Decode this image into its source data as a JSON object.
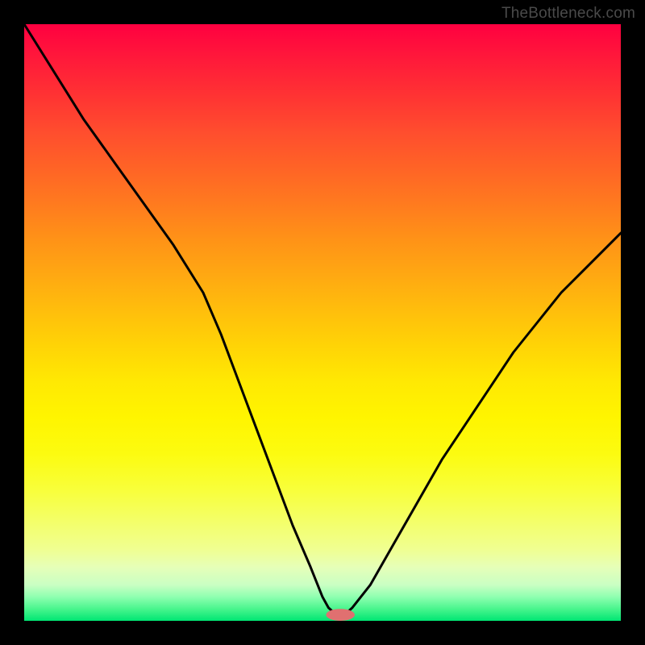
{
  "watermark": "TheBottleneck.com",
  "chart_data": {
    "type": "line",
    "title": "",
    "xlabel": "",
    "ylabel": "",
    "xlim": [
      0,
      100
    ],
    "ylim": [
      0,
      100
    ],
    "grid": false,
    "legend": false,
    "background": "heat-gradient",
    "series": [
      {
        "name": "bottleneck-curve",
        "x": [
          0,
          5,
          10,
          15,
          20,
          25,
          30,
          33,
          36,
          39,
          42,
          45,
          48,
          50,
          51,
          52,
          53,
          54,
          55,
          58,
          62,
          66,
          70,
          74,
          78,
          82,
          86,
          90,
          94,
          98,
          100
        ],
        "values": [
          100,
          92,
          84,
          77,
          70,
          63,
          55,
          48,
          40,
          32,
          24,
          16,
          9,
          4,
          2.2,
          1.3,
          1.0,
          1.3,
          2.2,
          6,
          13,
          20,
          27,
          33,
          39,
          45,
          50,
          55,
          59,
          63,
          65
        ]
      }
    ],
    "marker": {
      "x": 53,
      "y": 1,
      "rx": 2.4,
      "ry": 1.0,
      "color": "#e07070"
    }
  }
}
